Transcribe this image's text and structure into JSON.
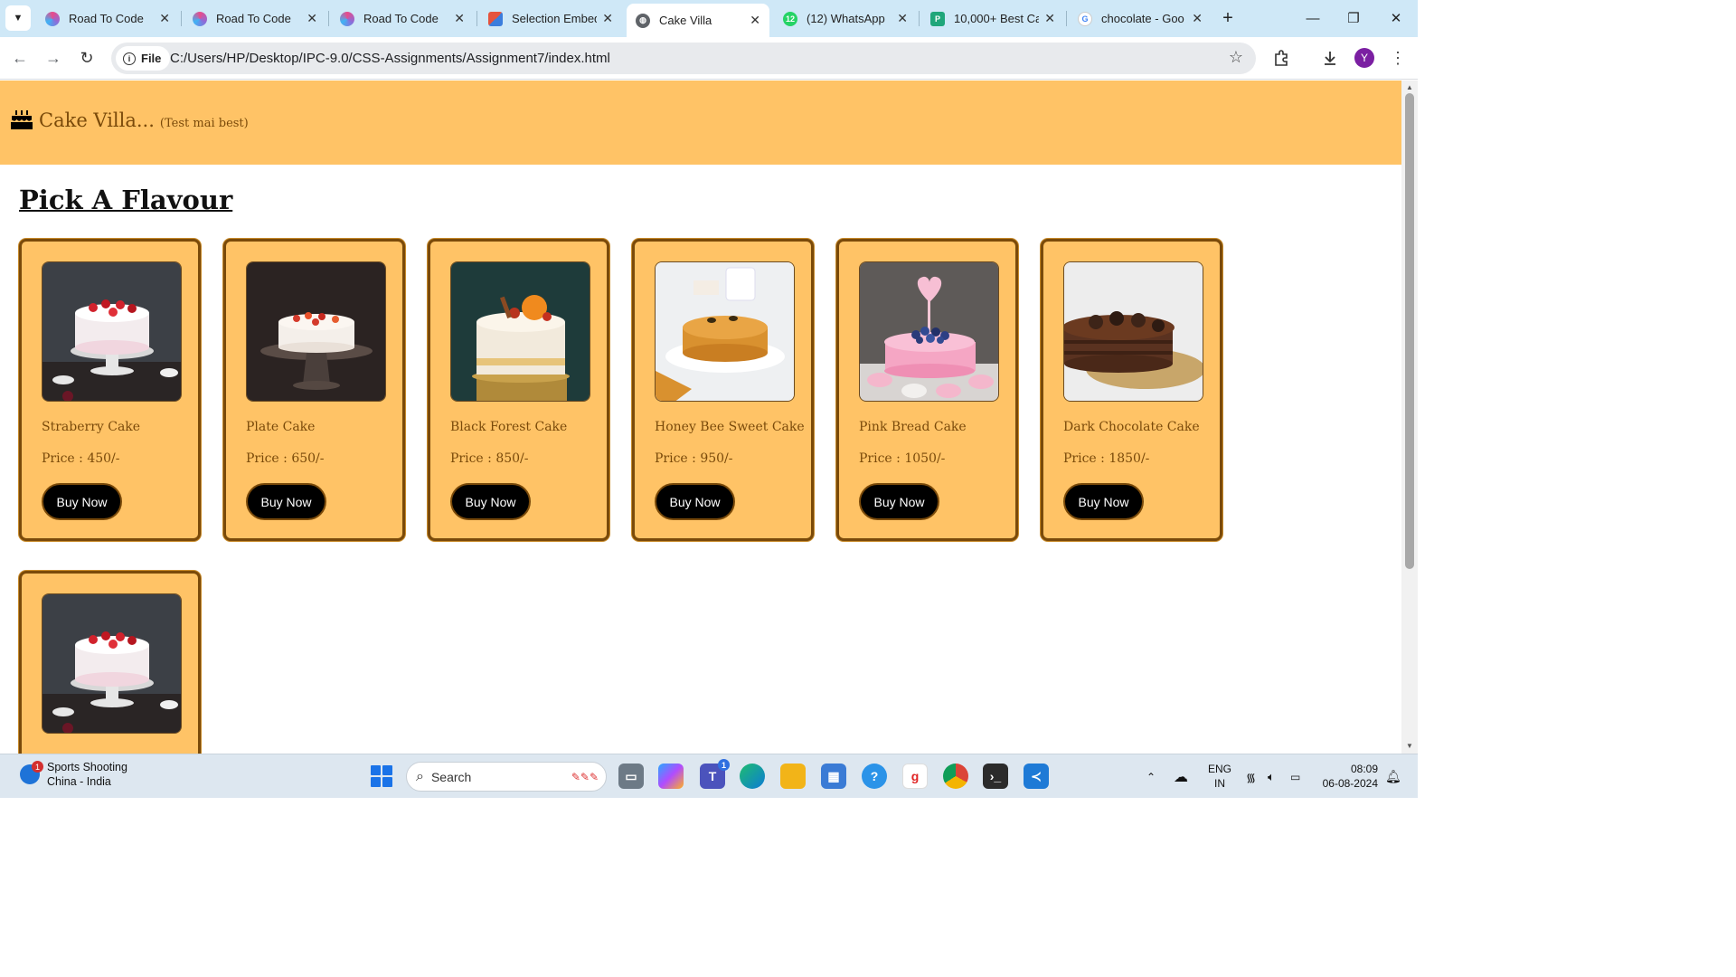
{
  "browser": {
    "tabs": [
      {
        "title": "Road To Code",
        "favicon_color": "#8e6bd8"
      },
      {
        "title": "Road To Code",
        "favicon_color": "#8e6bd8"
      },
      {
        "title": "Road To Code",
        "favicon_color": "#8e6bd8"
      },
      {
        "title": "Selection Embed",
        "favicon_color": "#e5533d"
      },
      {
        "title": "Cake Villa",
        "favicon_color": "#5f6368"
      },
      {
        "title": "(12) WhatsApp",
        "favicon_color": "#25d366"
      },
      {
        "title": "10,000+ Best Ca",
        "favicon_color": "#1fa67a"
      },
      {
        "title": "chocolate - Goo",
        "favicon_color": "#4285f4"
      }
    ],
    "active_tab_index": 4,
    "address_chip": "File",
    "url": "C:/Users/HP/Desktop/IPC-9.0/CSS-Assignments/Assignment7/index.html",
    "profile_initial": "Y"
  },
  "site": {
    "name": "Cake Villa...",
    "tagline": "(Test mai best)",
    "section_title": "Pick A Flavour",
    "buy_label": "Buy Now",
    "cards": [
      {
        "name": "Straberry Cake",
        "price": "Price : 450/-",
        "image": "strawberry-cake"
      },
      {
        "name": "Plate Cake",
        "price": "Price : 650/-",
        "image": "plate-cake"
      },
      {
        "name": "Black Forest Cake",
        "price": "Price : 850/-",
        "image": "black-forest-cake"
      },
      {
        "name": "Honey Bee Sweet Cake",
        "price": "Price : 950/-",
        "image": "honey-cake"
      },
      {
        "name": "Pink Bread Cake",
        "price": "Price : 1050/-",
        "image": "pink-cake"
      },
      {
        "name": "Dark Chocolate Cake",
        "price": "Price : 1850/-",
        "image": "chocolate-cake"
      },
      {
        "name": "",
        "price": "",
        "image": "strawberry-cake"
      }
    ]
  },
  "taskbar": {
    "weather_title": "Sports Shooting",
    "weather_sub": "China - India",
    "weather_badge": "1",
    "search_placeholder": "Search",
    "teams_badge": "1",
    "lang_1": "ENG",
    "lang_2": "IN",
    "time": "08:09",
    "date": "06-08-2024"
  }
}
